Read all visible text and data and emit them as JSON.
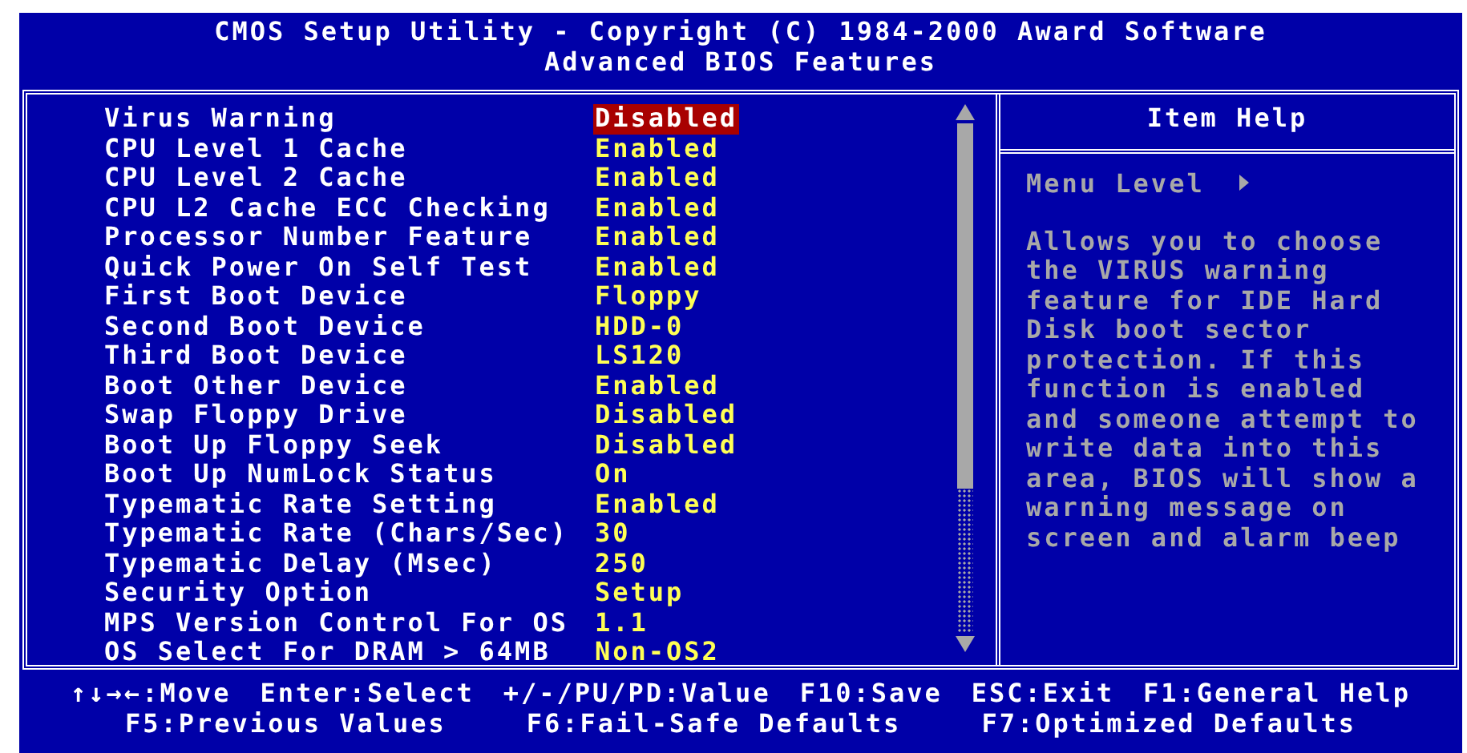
{
  "header": {
    "title": "CMOS Setup Utility - Copyright (C) 1984-2000 Award Software",
    "subtitle": "Advanced BIOS Features"
  },
  "settings": [
    {
      "label": "Virus Warning",
      "value": "Disabled",
      "selected": true
    },
    {
      "label": "CPU Level 1 Cache",
      "value": "Enabled",
      "selected": false
    },
    {
      "label": "CPU Level 2 Cache",
      "value": "Enabled",
      "selected": false
    },
    {
      "label": "CPU L2 Cache ECC Checking",
      "value": "Enabled",
      "selected": false
    },
    {
      "label": "Processor Number Feature",
      "value": "Enabled",
      "selected": false
    },
    {
      "label": "Quick Power On Self Test",
      "value": "Enabled",
      "selected": false
    },
    {
      "label": "First Boot Device",
      "value": "Floppy",
      "selected": false
    },
    {
      "label": "Second Boot Device",
      "value": "HDD-0",
      "selected": false
    },
    {
      "label": "Third Boot Device",
      "value": "LS120",
      "selected": false
    },
    {
      "label": "Boot Other Device",
      "value": "Enabled",
      "selected": false
    },
    {
      "label": "Swap Floppy Drive",
      "value": "Disabled",
      "selected": false
    },
    {
      "label": "Boot Up Floppy Seek",
      "value": "Disabled",
      "selected": false
    },
    {
      "label": "Boot Up NumLock Status",
      "value": "On",
      "selected": false
    },
    {
      "label": "Typematic Rate Setting",
      "value": "Enabled",
      "selected": false
    },
    {
      "label": "Typematic Rate (Chars/Sec)",
      "value": "30",
      "selected": false
    },
    {
      "label": "Typematic Delay (Msec)",
      "value": "250",
      "selected": false
    },
    {
      "label": "Security Option",
      "value": "Setup",
      "selected": false
    },
    {
      "label": "MPS Version Control For OS",
      "value": "1.1",
      "selected": false
    },
    {
      "label": "OS Select For DRAM > 64MB",
      "value": "Non-OS2",
      "selected": false
    }
  ],
  "item_help": {
    "title": "Item Help",
    "menu_level": "Menu Level",
    "text": "Allows you to choose\nthe VIRUS warning\nfeature for IDE Hard\nDisk boot sector\nprotection. If this\nfunction is enabled\nand someone attempt to\nwrite data into this\narea, BIOS will show a\nwarning message on\nscreen and alarm beep"
  },
  "footer": [
    [
      "↑↓→←:Move",
      "Enter:Select",
      "+/-/PU/PD:Value",
      "F10:Save",
      "ESC:Exit",
      "F1:General Help"
    ],
    [
      "F5:Previous Values",
      "F6:Fail-Safe Defaults",
      "F7:Optimized Defaults"
    ]
  ]
}
